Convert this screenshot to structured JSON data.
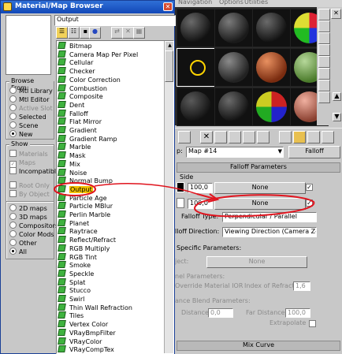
{
  "editor": {
    "menu": [
      "Navigation",
      "Options",
      "Utilities"
    ],
    "map_name": "Map #14",
    "map_type_button": "Falloff",
    "falloff_params_title": "Falloff Parameters",
    "front_side_label": "Side",
    "rows": [
      {
        "amount": "100,0",
        "map": "None"
      },
      {
        "amount": "100,0",
        "map": "None"
      }
    ],
    "falloff_type_label": "Falloff Type:",
    "falloff_type_value": "Perpendicular / Parallel",
    "falloff_direction_label": "lloff Direction:",
    "falloff_direction_value": "Viewing Direction (Camera Z-Axis)",
    "specific_title": "Specific Parameters:",
    "override_obj_label": "ject:",
    "override_obj_value": "None",
    "fresnel_label": "nel Parameters:",
    "override_ior_label": "Override Material IOR",
    "ior_label": "Index of Refraction",
    "ior_value": "1,6",
    "distance_blend_label": "ance Blend Parameters:",
    "near_distance_label": "Distance:",
    "near_distance_value": "0,0",
    "far_distance_label": "Far Distance:",
    "far_distance_value": "100,0",
    "extrapolate_label": "Extrapolate",
    "mix_curve_title": "Mix Curve"
  },
  "browser": {
    "title": "Material/Map Browser",
    "search_value": "Output",
    "browse_from_title": "Browse From:",
    "browse_from": [
      {
        "label": "Mtl Library",
        "selected": false,
        "disabled": false
      },
      {
        "label": "Mtl Editor",
        "selected": false,
        "disabled": false
      },
      {
        "label": "Active Slot",
        "selected": false,
        "disabled": true
      },
      {
        "label": "Selected",
        "selected": false,
        "disabled": false
      },
      {
        "label": "Scene",
        "selected": false,
        "disabled": false
      },
      {
        "label": "New",
        "selected": true,
        "disabled": false
      }
    ],
    "show_title": "Show",
    "show_items": [
      {
        "label": "Materials",
        "checked": false,
        "disabled": true
      },
      {
        "label": "Maps",
        "checked": true,
        "disabled": true
      },
      {
        "label": "Incompatible",
        "checked": false,
        "disabled": false
      }
    ],
    "show_items2": [
      {
        "label": "Root Only",
        "checked": false,
        "disabled": true
      },
      {
        "label": "By Object",
        "checked": false,
        "disabled": true
      }
    ],
    "categories": [
      {
        "label": "2D maps",
        "selected": false
      },
      {
        "label": "3D maps",
        "selected": false
      },
      {
        "label": "Compositors",
        "selected": false
      },
      {
        "label": "Color Mods",
        "selected": false
      },
      {
        "label": "Other",
        "selected": false
      },
      {
        "label": "All",
        "selected": true
      }
    ],
    "maps": [
      "Bitmap",
      "Camera Map Per Pixel",
      "Cellular",
      "Checker",
      "Color Correction",
      "Combustion",
      "Composite",
      "Dent",
      "Falloff",
      "Flat Mirror",
      "Gradient",
      "Gradient Ramp",
      "Marble",
      "Mask",
      "Mix",
      "Noise",
      "Normal Bump",
      "Output",
      "Particle Age",
      "Particle MBlur",
      "Perlin Marble",
      "Planet",
      "Raytrace",
      "Reflect/Refract",
      "RGB Multiply",
      "RGB Tint",
      "Smoke",
      "Speckle",
      "Splat",
      "Stucco",
      "Swirl",
      "Thin Wall Refraction",
      "Tiles",
      "Vertex Color",
      "VRayBmpFilter",
      "VRayColor",
      "VRayCompTex"
    ],
    "highlighted": "Output"
  },
  "colors": {
    "annotation": "#e0141e",
    "highlight": "#f2c200",
    "map_icon": "#3fb23f"
  }
}
